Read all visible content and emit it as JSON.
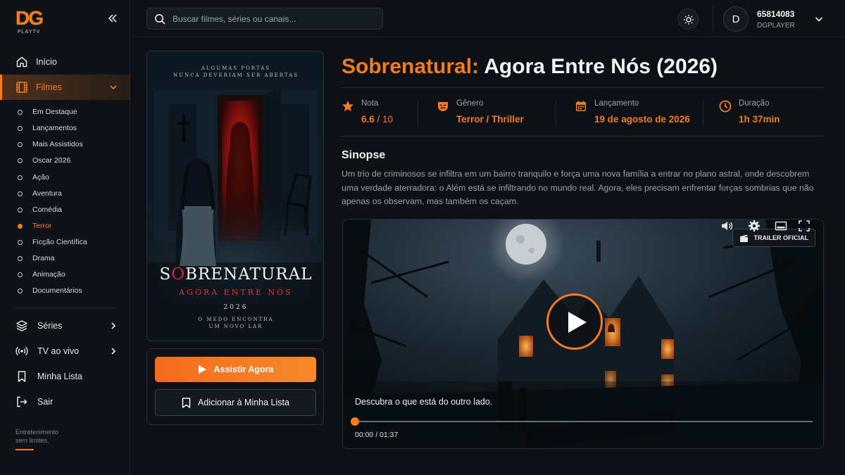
{
  "brand": {
    "logo_text": "DG",
    "logo_sub": "PLAYTV"
  },
  "sidebar": {
    "items": [
      {
        "label": "Início",
        "icon": "home-icon"
      },
      {
        "label": "Filmes",
        "icon": "film-icon",
        "active": true,
        "expanded": true
      },
      {
        "label": "Séries",
        "icon": "layers-icon"
      },
      {
        "label": "TV ao vivo",
        "icon": "broadcast-icon"
      },
      {
        "label": "Minha Lista",
        "icon": "bookmark-icon"
      },
      {
        "label": "Sair",
        "icon": "logout-icon"
      }
    ],
    "subitems": [
      {
        "label": "Em Destaque"
      },
      {
        "label": "Lançamentos"
      },
      {
        "label": "Mais Assistidos"
      },
      {
        "label": "Oscar 2026"
      },
      {
        "label": "Ação"
      },
      {
        "label": "Aventura"
      },
      {
        "label": "Comédia"
      },
      {
        "label": "Terror",
        "active": true
      },
      {
        "label": "Ficção Científica"
      },
      {
        "label": "Drama"
      },
      {
        "label": "Animação"
      },
      {
        "label": "Documentários"
      }
    ],
    "tagline_1": "Entretenimento",
    "tagline_2": "sem limites."
  },
  "header": {
    "search_placeholder": "Buscar filmes, séries ou canais...",
    "user_initial": "D",
    "user_id": "65814083",
    "user_name": "DGPLAYER"
  },
  "poster": {
    "top_line_1": "ALGUMAS PORTAS",
    "top_line_2": "NUNCA DEVERIAM SER ABERTAS",
    "title_a": "S",
    "title_o": "O",
    "title_b": "BRENATURAL",
    "subtitle": "AGORA ENTRE NÓS",
    "year": "2026",
    "tag_1": "O MEDO ENCONTRA",
    "tag_2": "UM NOVO LAR"
  },
  "actions": {
    "watch_label": "Assistir Agora",
    "list_label": "Adicionar à Minha Lista"
  },
  "movie": {
    "title_accent": "Sobrenatural:",
    "title_rest": " Agora Entre Nós (2026)",
    "meta": {
      "rating_label": "Nota",
      "rating_value": "6.6",
      "rating_max": " / 10",
      "genre_label": "Gênero",
      "genre_value": "Terror / Thriller",
      "release_label": "Lançamento",
      "release_value": "19 de agosto de 2026",
      "duration_label": "Duração",
      "duration_value": "1h 37min"
    },
    "synopsis_title": "Sinopse",
    "synopsis": "Um trio de criminosos se infiltra em um bairro tranquilo e força uma nova família a entrar no plano astral, onde descobrem uma verdade aterradora: o Além está se infiltrando no mundo real. Agora, eles precisam enfrentar forças sombrias que não apenas os observam, mas também os caçam."
  },
  "player": {
    "badge": "TRAILER OFICIAL",
    "caption": "Descubra o que está do outro lado.",
    "time": "00:00 / 01:37",
    "progress": 0
  },
  "colors": {
    "accent": "#f47b20",
    "background": "#0d1015"
  }
}
